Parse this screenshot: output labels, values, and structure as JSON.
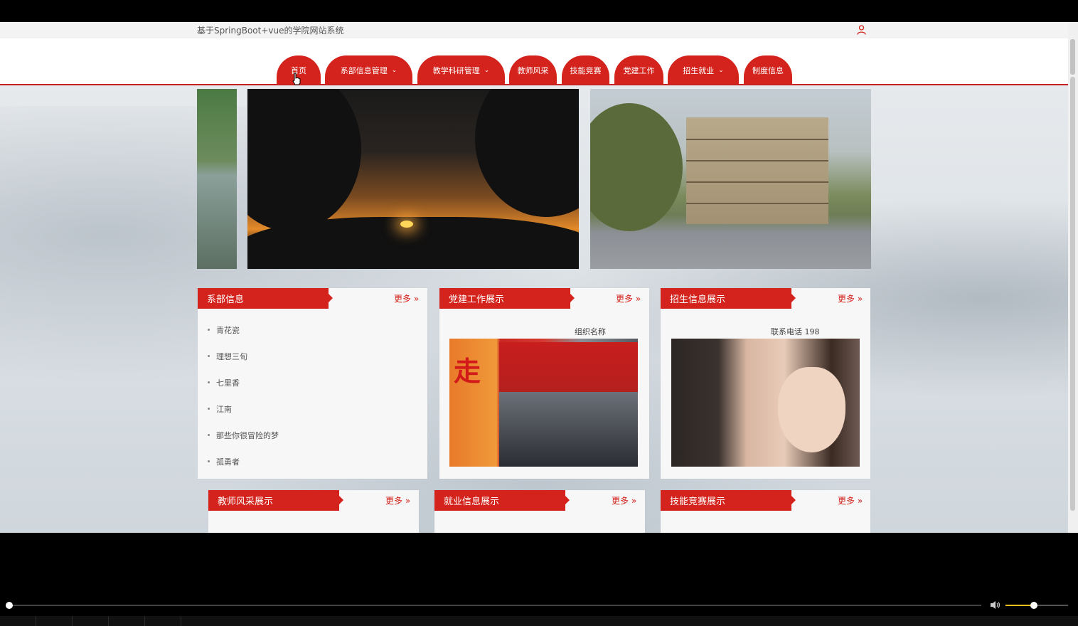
{
  "site": {
    "title": "基于SpringBoot+vue的学院网站系统"
  },
  "nav": {
    "items": [
      {
        "label": "首页",
        "dropdown": false
      },
      {
        "label": "系部信息管理",
        "dropdown": true
      },
      {
        "label": "教学科研管理",
        "dropdown": true
      },
      {
        "label": "教师风采",
        "dropdown": false
      },
      {
        "label": "技能竞赛",
        "dropdown": false
      },
      {
        "label": "党建工作",
        "dropdown": false
      },
      {
        "label": "招生就业",
        "dropdown": true
      },
      {
        "label": "制度信息",
        "dropdown": false
      }
    ]
  },
  "panels": {
    "dept": {
      "title": "系部信息",
      "more": "更多 »",
      "items": [
        "青花瓷",
        "理想三旬",
        "七里香",
        "江南",
        "那些你很冒险的梦",
        "孤勇者"
      ]
    },
    "party": {
      "title": "党建工作展示",
      "more": "更多 »",
      "meta": "组织名称"
    },
    "enroll": {
      "title": "招生信息展示",
      "more": "更多 »",
      "meta": "联系电话 198"
    },
    "teacher": {
      "title": "教师风采展示",
      "more": "更多 »"
    },
    "job": {
      "title": "就业信息展示",
      "more": "更多 »"
    },
    "skill": {
      "title": "技能竞赛展示",
      "more": "更多 »"
    }
  },
  "player": {
    "progress": 0.0,
    "volume": 0.45
  },
  "colors": {
    "accent": "#d3231c",
    "nav_text": "#ffffff"
  },
  "icons": {
    "user": "user-icon",
    "cursor": "hand-cursor-icon",
    "volume": "volume-icon"
  }
}
